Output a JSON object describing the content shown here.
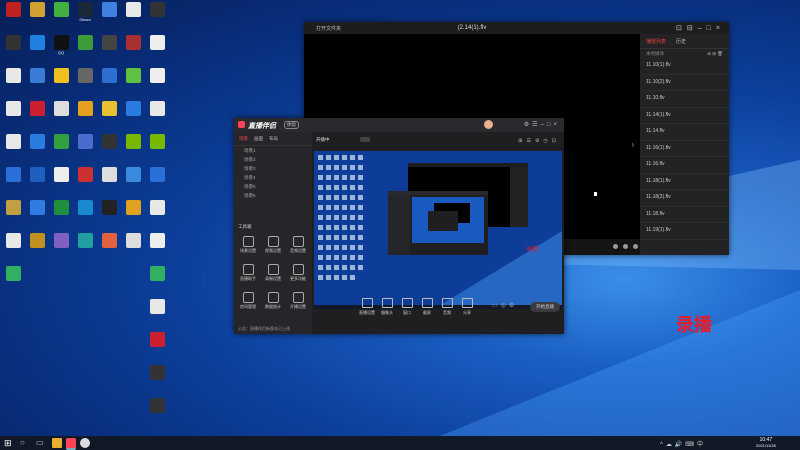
{
  "desktop_icons": [
    {
      "label": "",
      "color": "#c02020"
    },
    {
      "label": "",
      "color": "#d0a030"
    },
    {
      "label": "",
      "color": "#40b040"
    },
    {
      "label": "Steam",
      "color": "#1b2838"
    },
    {
      "label": "",
      "color": "#4080e0"
    },
    {
      "label": "",
      "color": "#e8e8e8"
    },
    {
      "label": "",
      "color": "#333"
    },
    {
      "label": "",
      "color": "#2080e0"
    },
    {
      "label": "QQ",
      "color": "#111"
    },
    {
      "label": "",
      "color": "#3c9c3c"
    },
    {
      "label": "",
      "color": "#444"
    },
    {
      "label": "",
      "color": "#aa3030"
    },
    {
      "label": "",
      "color": "#e8e8e8"
    },
    {
      "label": "",
      "color": "#3a7bd5"
    },
    {
      "label": "",
      "color": "#f0c020"
    },
    {
      "label": "",
      "color": "#666"
    },
    {
      "label": "",
      "color": "#2c6fd0"
    },
    {
      "label": "",
      "color": "#60c040"
    },
    {
      "label": "",
      "color": "#e8e8e8"
    },
    {
      "label": "",
      "color": "#cc2030"
    },
    {
      "label": "",
      "color": "#ddd"
    },
    {
      "label": "",
      "color": "#e6a020"
    },
    {
      "label": "",
      "color": "#e8c030"
    },
    {
      "label": "",
      "color": "#2a7be0"
    },
    {
      "label": "",
      "color": "#e8e8e8"
    },
    {
      "label": "",
      "color": "#2a7be0"
    },
    {
      "label": "",
      "color": "#30a040"
    },
    {
      "label": "",
      "color": "#4a6cd0"
    },
    {
      "label": "",
      "color": "#333"
    },
    {
      "label": "",
      "color": "#76b900"
    },
    {
      "label": "",
      "color": "#2b6fd8"
    },
    {
      "label": "",
      "color": "#1f5fbf"
    },
    {
      "label": "",
      "color": "#eee"
    },
    {
      "label": "",
      "color": "#cc3030"
    },
    {
      "label": "",
      "color": "#ddd"
    },
    {
      "label": "",
      "color": "#3a8ae0"
    },
    {
      "label": "",
      "color": "#c0a040"
    },
    {
      "label": "",
      "color": "#2f7de0"
    },
    {
      "label": "",
      "color": "#1f8f3f"
    },
    {
      "label": "",
      "color": "#1a8ad0"
    },
    {
      "label": "",
      "color": "#222"
    },
    {
      "label": "",
      "color": "#e0a020"
    },
    {
      "label": "",
      "color": "#e8e8e8"
    },
    {
      "label": "",
      "color": "#c09020"
    },
    {
      "label": "",
      "color": "#8060c0"
    },
    {
      "label": "",
      "color": "#20a0a0"
    },
    {
      "label": "",
      "color": "#e06040"
    },
    {
      "label": "",
      "color": "#ddd"
    },
    {
      "label": "",
      "color": "#30b060"
    }
  ],
  "player": {
    "title_left": "打开文件夹",
    "title_center": "(2.14(1).flv",
    "playlist_tab_active": "播放列表",
    "playlist_tab_other": "历史",
    "playlist_header": "本地媒体",
    "items": [
      "11.10(1).flv",
      "11.10(2).flv",
      "11.10.flv",
      "11.14(1).flv",
      "11.14.flv",
      "11.16(1).flv",
      "11.16.flv",
      "11.18(1).flv",
      "11.18(2).flv",
      "11.18.flv",
      "11.19(1).flv"
    ]
  },
  "recorder": {
    "app_name": "直播伴侣",
    "badge": "体验",
    "side_tabs": [
      "场景",
      "画面",
      "布局"
    ],
    "scenes": [
      "场景1",
      "场景2",
      "场景3",
      "场景4",
      "场景5",
      "场景6"
    ],
    "tools_header": "工具箱",
    "tools": [
      "场景设置",
      "视频设置",
      "音频设置",
      "直播助手",
      "录制设置",
      "更多功能",
      "房间管理",
      "数据统计",
      "开播设置"
    ],
    "bottom_tools": [
      "直播设置",
      "摄像头",
      "窗口",
      "截屏",
      "音频",
      "分享"
    ],
    "start_button": "开始直播",
    "status": "开播中",
    "ticker": "公告：直播伴侣新版本已上线"
  },
  "overlay_label": "录播",
  "taskbar": {
    "time": "10:47",
    "date": "2021/11/28"
  }
}
